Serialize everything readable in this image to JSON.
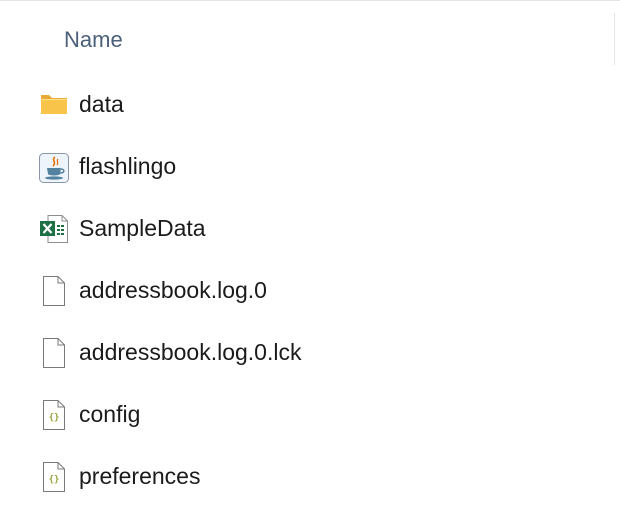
{
  "header": {
    "name_column": "Name"
  },
  "files": [
    {
      "name": "data",
      "icon": "folder-icon"
    },
    {
      "name": "flashlingo",
      "icon": "java-icon"
    },
    {
      "name": "SampleData",
      "icon": "excel-icon"
    },
    {
      "name": "addressbook.log.0",
      "icon": "generic-file-icon"
    },
    {
      "name": "addressbook.log.0.lck",
      "icon": "generic-file-icon"
    },
    {
      "name": "config",
      "icon": "json-file-icon"
    },
    {
      "name": "preferences",
      "icon": "json-file-icon"
    }
  ],
  "colors": {
    "header_text": "#4c607a",
    "folder": "#f8c44a",
    "excel_green": "#1d7145",
    "json_brace": "#9aa43a"
  }
}
